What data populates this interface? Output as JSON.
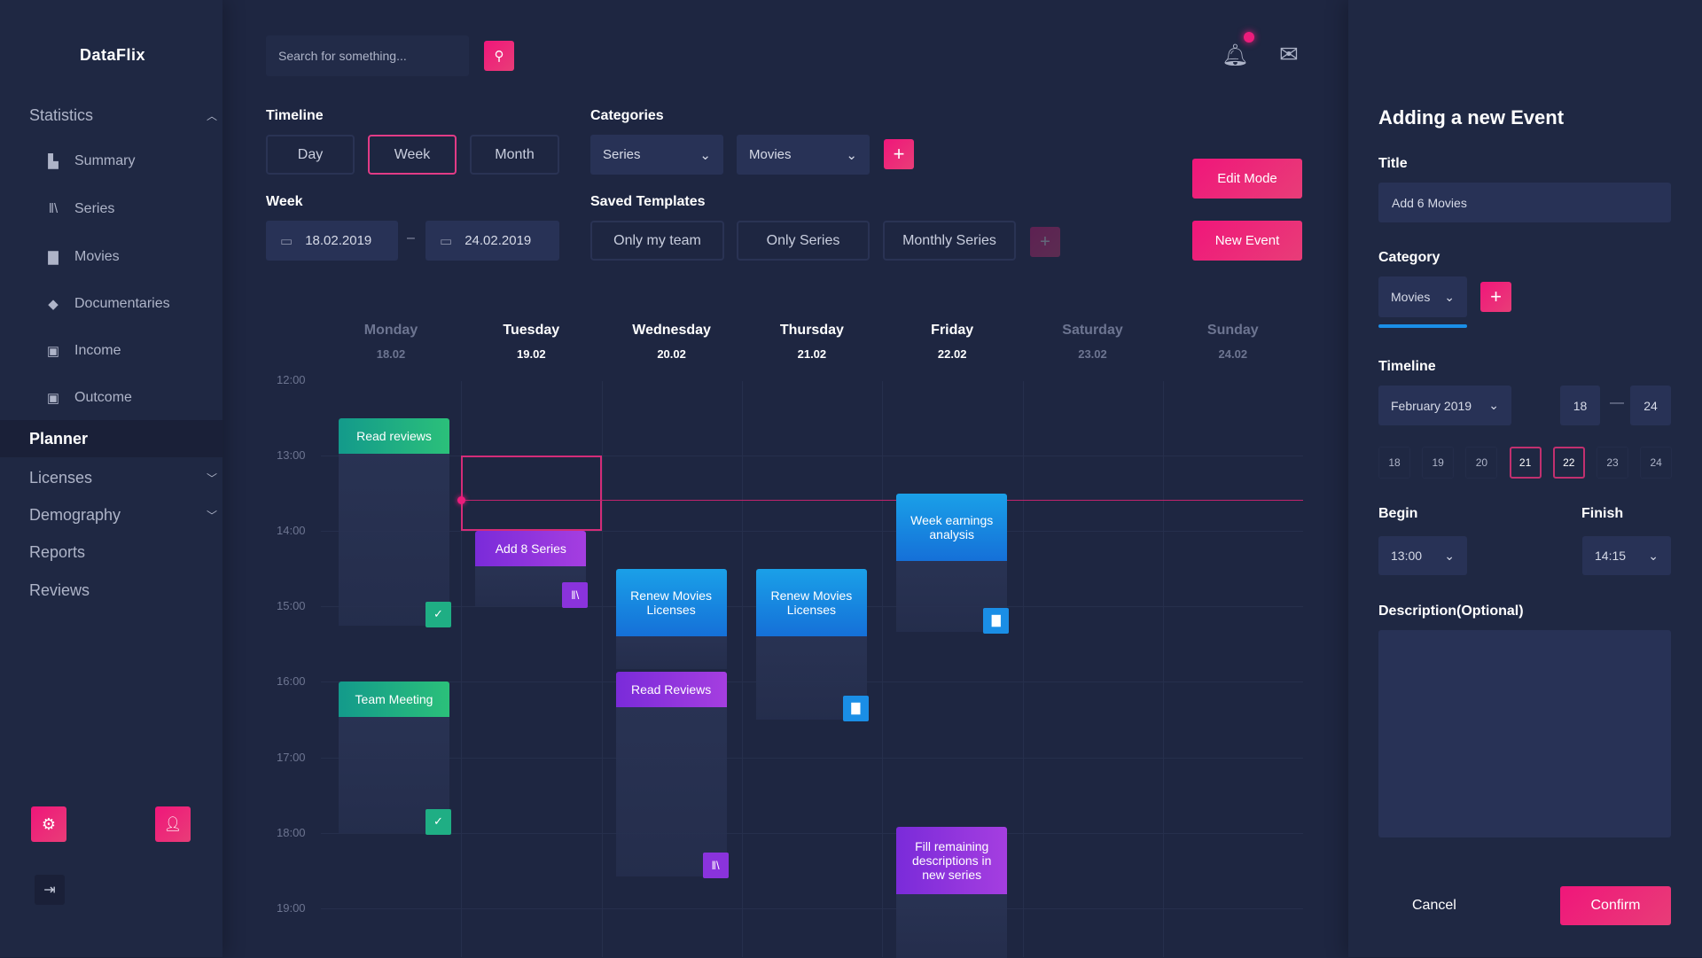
{
  "app": {
    "name": "DataFlix"
  },
  "sidebar": {
    "statistics": {
      "label": "Statistics",
      "items": [
        {
          "label": "Summary",
          "icon": "bar-chart-icon"
        },
        {
          "label": "Series",
          "icon": "books-icon"
        },
        {
          "label": "Movies",
          "icon": "clapperboard-icon"
        },
        {
          "label": "Documentaries",
          "icon": "graduation-cap-icon"
        },
        {
          "label": "Income",
          "icon": "clipboard-in-icon"
        },
        {
          "label": "Outcome",
          "icon": "clipboard-out-icon"
        }
      ]
    },
    "planner": "Planner",
    "licenses": "Licenses",
    "demography": "Demography",
    "reports": "Reports",
    "reviews": "Reviews"
  },
  "header": {
    "search_placeholder": "Search for something..."
  },
  "filters": {
    "timeline_label": "Timeline",
    "timeline_options": [
      "Day",
      "Week",
      "Month"
    ],
    "timeline_selected": "Week",
    "categories_label": "Categories",
    "category1": "Series",
    "category2": "Movies",
    "week_label": "Week",
    "week_start": "18.02.2019",
    "week_end": "24.02.2019",
    "dash": "–",
    "templates_label": "Saved Templates",
    "templates": [
      "Only my team",
      "Only Series",
      "Monthly Series"
    ],
    "edit_mode": "Edit Mode",
    "new_event": "New Event"
  },
  "calendar": {
    "days": [
      {
        "name": "Monday",
        "date": "18.02",
        "active": false
      },
      {
        "name": "Tuesday",
        "date": "19.02",
        "active": true
      },
      {
        "name": "Wednesday",
        "date": "20.02",
        "active": true
      },
      {
        "name": "Thursday",
        "date": "21.02",
        "active": true
      },
      {
        "name": "Friday",
        "date": "22.02",
        "active": true
      },
      {
        "name": "Saturday",
        "date": "23.02",
        "active": false
      },
      {
        "name": "Sunday",
        "date": "24.02",
        "active": false
      }
    ],
    "hours": [
      "12:00",
      "13:00",
      "14:00",
      "15:00",
      "16:00",
      "17:00",
      "18:00",
      "19:00"
    ],
    "current_time": "13:35",
    "selection": {
      "day": 1,
      "start": "13:00",
      "end": "14:00"
    },
    "events": [
      {
        "title": "Read reviews",
        "day": 0,
        "start": "12:30",
        "end": "15:15",
        "color": "green",
        "icon": "check-icon"
      },
      {
        "title": "Team Meeting",
        "day": 0,
        "start": "16:00",
        "end": "18:00",
        "color": "green",
        "icon": "check-icon"
      },
      {
        "title": "Add 8 Series",
        "day": 1,
        "start": "14:00",
        "end": "15:00",
        "color": "purple",
        "icon": "books-icon"
      },
      {
        "title": "Renew Movies Licenses",
        "day": 2,
        "start": "14:30",
        "end": "15:50",
        "color": "blue",
        "icon": ""
      },
      {
        "title": "Read Reviews",
        "day": 2,
        "start": "15:52",
        "end": "18:35",
        "color": "purple",
        "icon": "books-icon"
      },
      {
        "title": "Renew Movies Licenses",
        "day": 3,
        "start": "14:30",
        "end": "16:30",
        "color": "blue",
        "icon": "clapperboard-icon"
      },
      {
        "title": "Week earnings analysis",
        "day": 4,
        "start": "13:30",
        "end": "15:20",
        "color": "blue",
        "icon": "clapperboard-icon"
      },
      {
        "title": "Fill remaining descriptions in new series",
        "day": 4,
        "start": "17:55",
        "end": "19:40",
        "color": "purple",
        "icon": ""
      }
    ]
  },
  "panel": {
    "heading": "Adding a new Event",
    "title_label": "Title",
    "title_value": "Add 6 Movies",
    "category_label": "Category",
    "category_value": "Movies",
    "timeline_label": "Timeline",
    "month_value": "February 2019",
    "range_start": "18",
    "range_end": "24",
    "range_dash": "—",
    "days": [
      {
        "d": "18",
        "sel": false
      },
      {
        "d": "19",
        "sel": false
      },
      {
        "d": "20",
        "sel": false
      },
      {
        "d": "21",
        "sel": true
      },
      {
        "d": "22",
        "sel": true
      },
      {
        "d": "23",
        "sel": false
      },
      {
        "d": "24",
        "sel": false
      }
    ],
    "begin_label": "Begin",
    "begin_value": "13:00",
    "finish_label": "Finish",
    "finish_value": "14:15",
    "description_label": "Description(Optional)",
    "description_value": "",
    "cancel": "Cancel",
    "confirm": "Confirm"
  },
  "colors": {
    "accent": "#ec1c7b",
    "green": "#1fae84",
    "purple": "#8a33dc",
    "blue": "#1a8ee6",
    "bg": "#1e2641"
  }
}
